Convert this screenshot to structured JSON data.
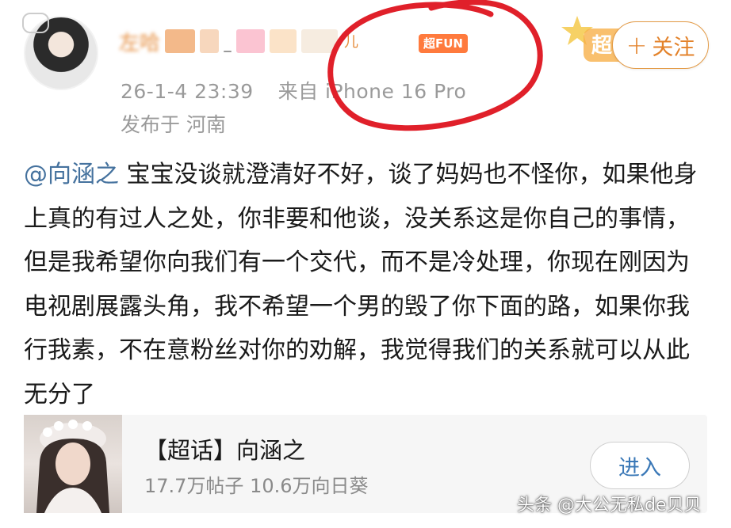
{
  "header": {
    "nickname_visible": "左哈",
    "nickname_suffix": "儿",
    "badge": "超FUN",
    "timestamp": "26-1-4 23:39",
    "source": "来自 iPhone 16 Pro",
    "location": "发布于 河南",
    "follow_label": "关注",
    "follow_icon": "plus-icon",
    "star_badge_label": "超"
  },
  "post": {
    "mention": "@向涵之",
    "text": " 宝宝没谈就澄清好不好，谈了妈妈也不怪你，如果他身上真的有过人之处，你非要和他谈，没关系这是你自己的事情，但是我希望你向我们有一个交代，而不是冷处理，你现在刚因为电视剧展露头角，我不希望一个男的毁了你下面的路，如果你我行我素，不在意粉丝对你的劝解，我觉得我们的关系就可以从此无分了"
  },
  "card": {
    "title": "【超话】向涵之",
    "stats": "17.7万帖子 10.6万向日葵",
    "enter_label": "进入"
  },
  "watermark": "头条 @大公无私de贝贝",
  "colors": {
    "accent_orange": "#e3822a",
    "mention_blue": "#45729e",
    "annotation_red": "#e0202a",
    "badge_orange": "#ff7a3d"
  }
}
